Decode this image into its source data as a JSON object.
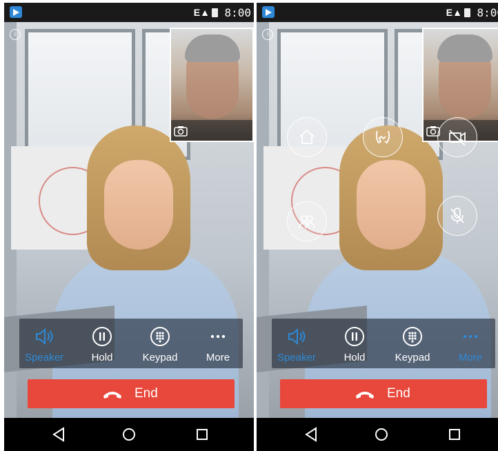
{
  "status_bar": {
    "time": "8:00",
    "network": "E"
  },
  "call_controls": {
    "speaker_label": "Speaker",
    "hold_label": "Hold",
    "keypad_label": "Keypad",
    "more_label": "More"
  },
  "end_button": {
    "label": "End"
  },
  "colors": {
    "accent": "#2f8ad8",
    "end": "#e8473b",
    "statusbar": "#1a1a1a",
    "navbar": "#000000"
  },
  "icons": {
    "floating_menu": [
      "home-icon",
      "call-transfer-icon",
      "video-off-icon",
      "conference-icon",
      "mute-mic-icon"
    ],
    "nav": [
      "back-icon",
      "home-circle-icon",
      "recents-icon"
    ]
  }
}
